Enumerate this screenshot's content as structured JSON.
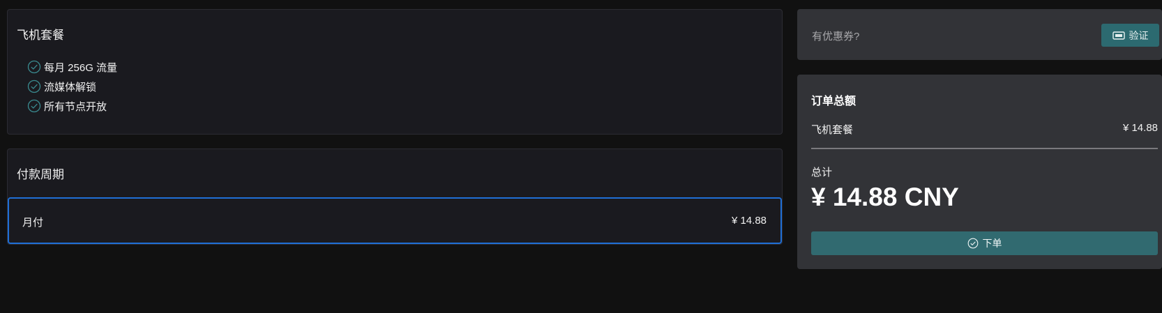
{
  "plan": {
    "title": "飞机套餐",
    "features": [
      "每月 256G 流量",
      "流媒体解锁",
      "所有节点开放"
    ]
  },
  "billing": {
    "title": "付款周期",
    "option": {
      "name": "月付",
      "price": "¥ 14.88"
    }
  },
  "coupon": {
    "label": "有优惠券?",
    "verify_label": "验证"
  },
  "summary": {
    "title": "订单总额",
    "line_item": {
      "name": "飞机套餐",
      "price": "¥ 14.88"
    },
    "total_label": "总计",
    "total_value": "¥ 14.88 CNY",
    "order_label": "下单"
  },
  "colors": {
    "accent": "#2c6a70",
    "selected_border": "#1f6fd6"
  },
  "icons": {
    "feature": "check-circle-icon",
    "verify": "ticket-icon",
    "order": "check-circle-icon"
  }
}
